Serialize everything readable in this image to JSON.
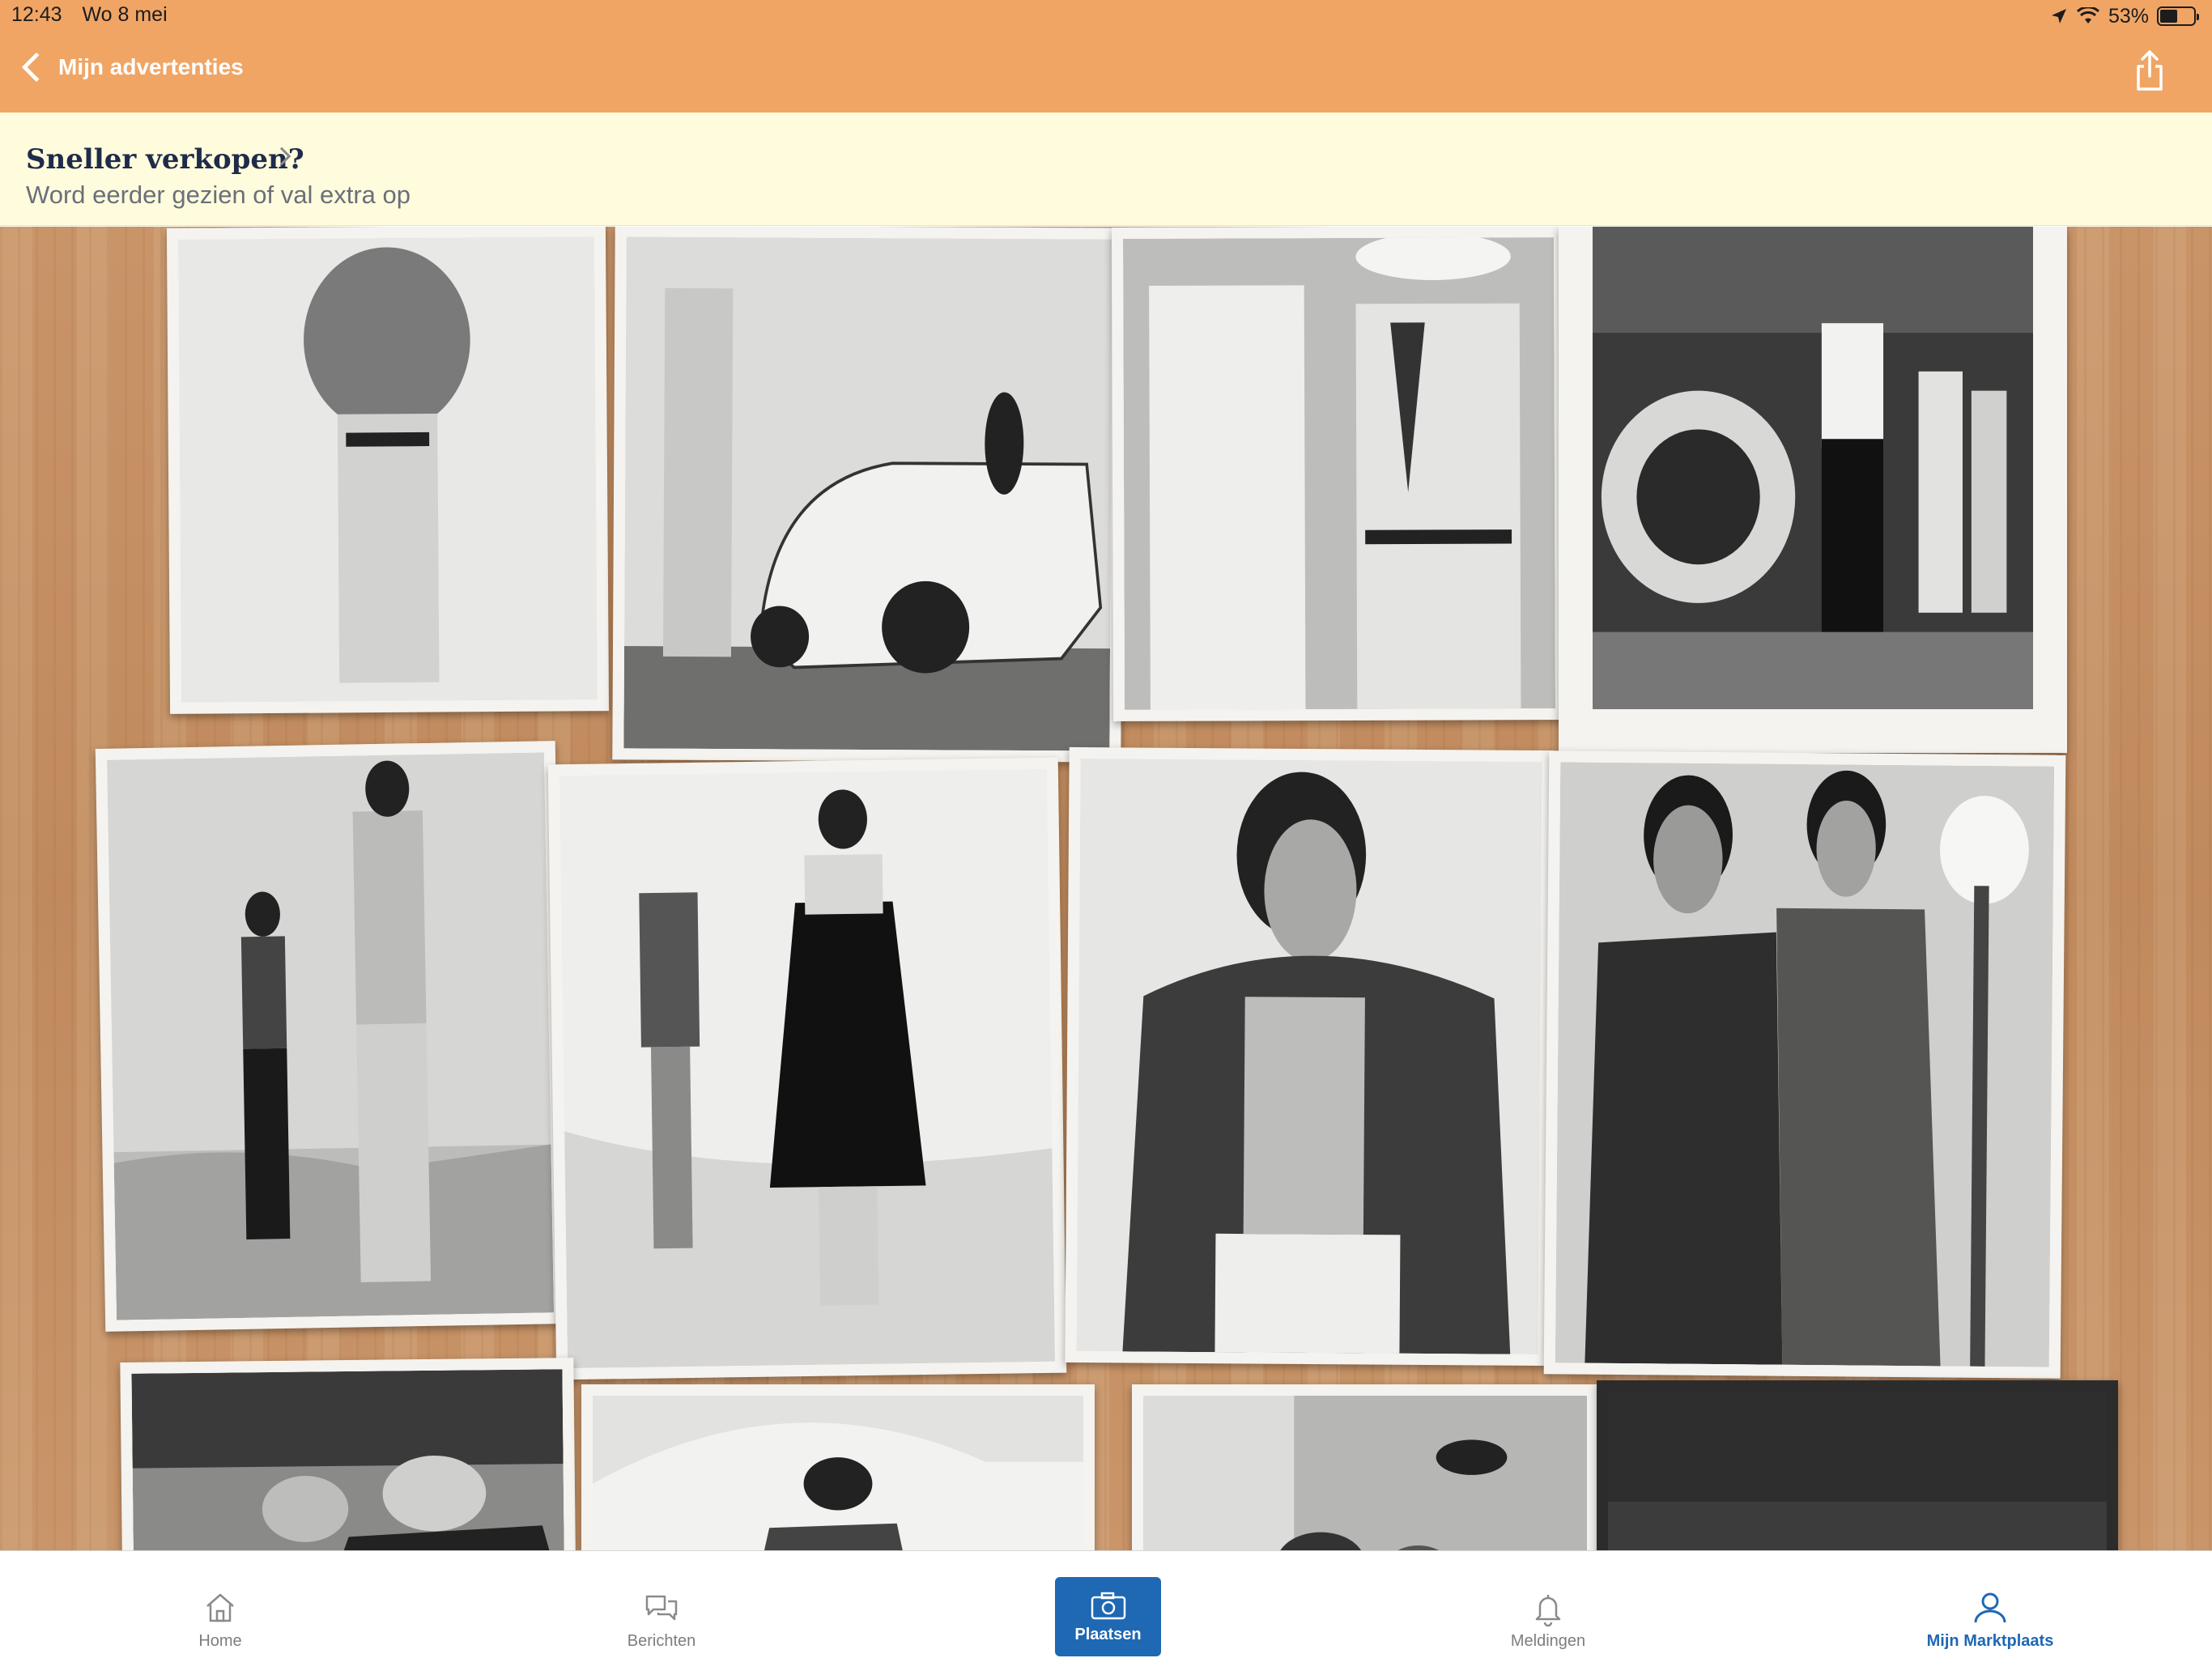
{
  "status_bar": {
    "time": "12:43",
    "date": "Wo 8 mei",
    "battery": "53%",
    "battery_level": 0.53
  },
  "nav": {
    "back_label": "Mijn advertenties"
  },
  "promo": {
    "title": "Sneller verkopen?",
    "subtitle": "Word eerder gezien of val extra op"
  },
  "tabs": [
    {
      "label": "Home",
      "icon": "home-icon"
    },
    {
      "label": "Berichten",
      "icon": "chat-bubbles-icon"
    },
    {
      "label": "Plaatsen",
      "icon": "camera-icon"
    },
    {
      "label": "Meldingen",
      "icon": "bell-icon"
    },
    {
      "label": "Mijn Marktplaats",
      "icon": "user-icon"
    }
  ],
  "colors": {
    "nav_orange": "#f0a565",
    "promo_bg": "#fefcdc",
    "accent_blue": "#1e68b4"
  }
}
